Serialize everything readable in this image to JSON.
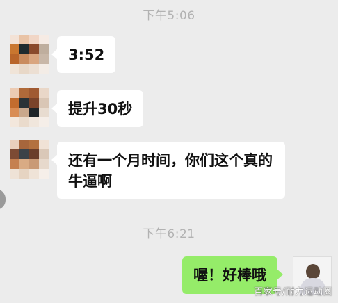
{
  "chat": {
    "timestamp_1": "下午5:06",
    "timestamp_2": "下午6:21",
    "messages": [
      {
        "side": "left",
        "text": "3:52"
      },
      {
        "side": "left",
        "text": "提升30秒"
      },
      {
        "side": "left",
        "text": "还有一个月时间，你们这个真的牛逼啊"
      },
      {
        "side": "right",
        "text": "喔！好棒哦"
      }
    ]
  },
  "watermark": "百家号/耐力运动圈",
  "colors": {
    "background": "#ececec",
    "incoming_bubble": "#ffffff",
    "outgoing_bubble": "#95ec69",
    "timestamp": "#b2b2b2"
  }
}
